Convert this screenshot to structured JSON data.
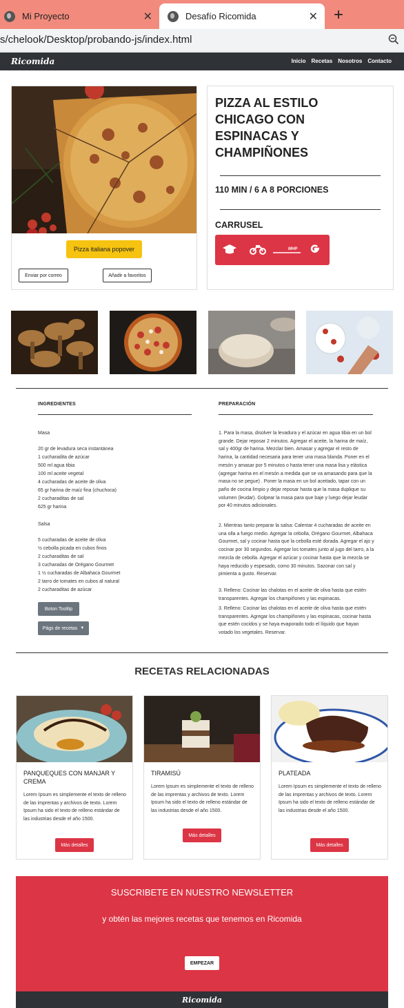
{
  "browser": {
    "tabs": [
      {
        "title": "Mi Proyecto",
        "active": false
      },
      {
        "title": "Desafío Ricomida",
        "active": true
      }
    ],
    "url": "s/chelook/Desktop/probando-js/index.html"
  },
  "nav": {
    "brand": "Ricomida",
    "links": [
      "Inicio",
      "Recetas",
      "Nosotros",
      "Contacto"
    ]
  },
  "hero": {
    "popover_button": "Pizza italiana popover",
    "email_button": "Enviar por correo",
    "favorites_button": "Añadir a favoritos",
    "title_lines": [
      "PIZZA AL ESTILO",
      "CHICAGO CON",
      "ESPINACAS Y",
      "CHAMPIÑONES"
    ],
    "time": "110 MIN / 6 A 8 PORCIONES",
    "carousel_label": "CARRUSEL",
    "carousel_icons": [
      "graduation-cap-icon",
      "motorcycle-icon",
      "brand-logo-icon",
      "google-icon"
    ]
  },
  "ingredients": {
    "heading": "INGREDIENTES",
    "masa_title": "Masa",
    "masa": [
      "20 gr de levadura seca instantánea",
      "1 cucharadita de azúcar",
      "500 ml agua tibia",
      "100 ml aceite vegetal",
      "4 cucharadas de aceite de oliva",
      "65 gr harina de maíz fina (chuchoca)",
      "2 cucharaditas de sal",
      "625 gr harina"
    ],
    "salsa_title": "Salsa",
    "salsa": [
      "5 cucharadas de aceite de oliva",
      "½ cebolla picada en cubos finos",
      "2 cucharaditas de sal",
      "3 cucharadas de Orégano Gourmet",
      "1 ½ cucharadas de Albahaca Gourmet",
      "2 tarro de tomates en cubos al natural",
      "2 cucharaditas de azúcar"
    ],
    "tooltip_button": "Boton Tooltip",
    "dropdown_button": "Págs de recetas"
  },
  "preparation": {
    "heading": "PREPARACIÓN",
    "steps": [
      "1. Para la masa, disolver la levadura y el azúcar en agua tibia en un bol grande. Dejar reposar 2 minutos. Agregar el aceite, la harina de maíz, sal y 400gr de harina. Mezclar bien. Amasar y agregar el resto de harina, la cantidad necesaria para tener una masa blanda. Poner en el mesón y amasar por 5 minutos o hasta tener una masa lisa y elástica (agregar harina en el mesón a medida que se va amasando para que la masa no se pegue) . Poner la masa en un bol aceitado, tapar con un paño de cocina limpio y dejar reposar hasta que la masa duplique su volumen (leudar). Golpear la masa para que baje y luego dejar leudar por 40 minutos adicionales.",
      "2. Mientras tanto preparar la salsa: Calentar 4 cucharadas de aceite en una olla a fuego medio. Agregar la cebolla, Orégano Gourmet, Albahaca Gourmet, sal y cocinar hasta que la cebolla esté dorada. Agregar el ajo y cocinar por 30 segundos. Agregar los tomates junto al jugo del tarro, a la mezcla de cebolla. Agregar el azúcar y cocinar hasta que la mezcla se haya reducido y espesado, como 30 minutos. Sazonar con sal y pimienta a gusto. Reservar.",
      "3. Relleno: Cocinar las chalotas en el aceite de oliva hasta que estén transparentes. Agregar los champiñones y las espinacas.",
      "3. Relleno: Cocinar las chalotas en el aceite de oliva hasta que estén transparentes. Agregar los champiñones y las espinacas, cocinar hasta que estén cocidos y se haya evaporado todo el líquido que hayan votado los vegetales. Reservar."
    ]
  },
  "related": {
    "title": "RECETAS RELACIONADAS",
    "cards": [
      {
        "title": "PANQUEQUES CON MANJAR Y CREMA",
        "text": "Lorem Ipsum es simplemente el texto de relleno de las imprentas y archivos de texto. Lorem Ipsum ha sido el texto de relleno estándar de las industrias desde el año 1500.",
        "button": "Más detalles"
      },
      {
        "title": "TIRAMISÚ",
        "text": "Lorem Ipsum es simplemente el texto de relleno de las imprentas y archivos de texto. Lorem Ipsum ha sido el texto de relleno estándar de las industrias desde el año 1500.",
        "button": "Más detalles"
      },
      {
        "title": "PLATEADA",
        "text": "Lorem Ipsum es simplemente el texto de relleno de las imprentas y archivos de texto. Lorem Ipsum ha sido el texto de relleno estándar de las industrias desde el año 1500.",
        "button": "Más detalles"
      }
    ]
  },
  "newsletter": {
    "title": "SUSCRIBETE EN NUESTRO NEWSLETTER",
    "subtitle": "y obtén las mejores recetas que tenemos en Ricomida",
    "button": "EMPEZAR"
  },
  "footer": {
    "brand": "Ricomida"
  },
  "colors": {
    "accent": "#dc3545",
    "nav": "#2f3237",
    "tabbar": "#f28b7d",
    "popover": "#f5c310",
    "grey_button": "#6c757d"
  }
}
